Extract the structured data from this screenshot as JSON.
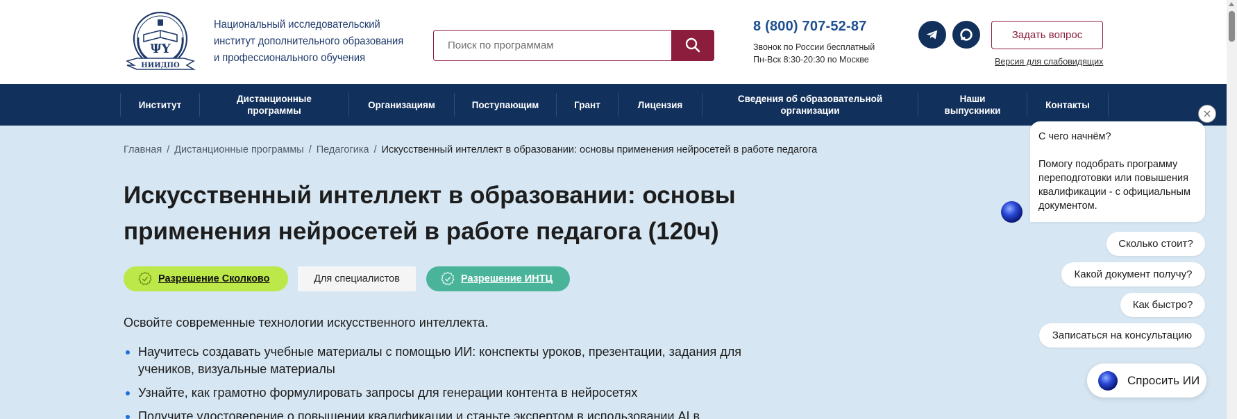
{
  "header": {
    "logo_abbr": "НИИДПО",
    "logo_lines": [
      "Национальный исследовательский",
      "институт дополнительного образования",
      "и профессионального обучения"
    ],
    "search_placeholder": "Поиск по программам",
    "phone": "8 (800) 707-52-87",
    "phone_note_1": "Звонок по России бесплатный",
    "phone_note_2": "Пн-Вск 8:30-20:30 по Москве",
    "ask_button": "Задать вопрос",
    "vision_link": "Версия для слабовидящих"
  },
  "nav": [
    {
      "label": "Институт"
    },
    {
      "label": "Дистанционные программы"
    },
    {
      "label": "Организациям"
    },
    {
      "label": "Поступающим"
    },
    {
      "label": "Грант"
    },
    {
      "label": "Лицензия"
    },
    {
      "label": "Сведения об образовательной организации"
    },
    {
      "label": "Наши выпускники"
    },
    {
      "label": "Контакты"
    }
  ],
  "breadcrumb": [
    "Главная",
    "Дистанционные программы",
    "Педагогика",
    "Искусственный интеллект в образовании: основы применения нейросетей в работе педагога"
  ],
  "page": {
    "title_line1": "Искусственный интеллект в образовании: основы",
    "title_line2": "применения нейросетей в работе педагога (120ч)",
    "badge_skolkovo": "Разрешение Сколково",
    "badge_specialists": "Для специалистов",
    "badge_intc": "Разрешение ИНТЦ",
    "intro": "Освойте современные технологии искусственного интеллекта.",
    "bullets": [
      "Научитесь создавать учебные материалы с помощью ИИ: конспекты уроков, презентации, задания для учеников, визуальные материалы",
      "Узнайте, как грамотно формулировать запросы для генерации контента в нейросетях",
      "Получите удостоверение о повышении квалификации и станьте экспертом в использовании AI в"
    ]
  },
  "chat": {
    "greeting": "С чего начнём?",
    "message": "Помогу подобрать программу переподготовки или повышения квалификации - с официальным документом.",
    "quick_replies": [
      "Сколько стоит?",
      "Какой документ получу?",
      "Как быстро?",
      "Записаться на консультацию"
    ],
    "ask_ai": "Спросить ИИ"
  },
  "colors": {
    "brand_navy": "#11305c",
    "brand_burgundy": "#8c1d3c",
    "page_bg": "#d6e6f2",
    "badge_green": "#bde84a",
    "badge_teal": "#4ab49a"
  }
}
